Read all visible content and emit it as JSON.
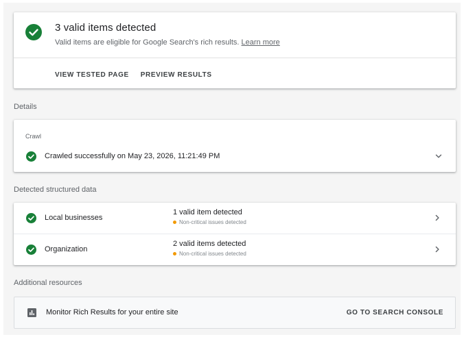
{
  "summary": {
    "title": "3 valid items detected",
    "subtitle": "Valid items are eligible for Google Search's rich results.",
    "learn_more": "Learn more",
    "actions": [
      "VIEW TESTED PAGE",
      "PREVIEW RESULTS"
    ]
  },
  "details": {
    "label": "Details",
    "crawl": {
      "label": "Crawl",
      "status": "Crawled successfully on May 23, 2026, 11:21:49 PM"
    }
  },
  "structured": {
    "label": "Detected structured data",
    "items": [
      {
        "name": "Local businesses",
        "status": "1 valid item detected",
        "note": "Non-critical issues detected"
      },
      {
        "name": "Organization",
        "status": "2 valid items detected",
        "note": "Non-critical issues detected"
      }
    ]
  },
  "resources": {
    "label": "Additional resources",
    "text": "Monitor Rich Results for your entire site",
    "cta": "GO TO SEARCH CONSOLE"
  },
  "colors": {
    "success": "#188038",
    "warning": "#f29900",
    "background": "#f5f5f5"
  },
  "icons": {
    "valid": "check-circle-icon",
    "expand": "chevron-down-icon",
    "open": "chevron-right-icon",
    "report": "bar-chart-icon",
    "warning": "warning-dot-icon"
  }
}
